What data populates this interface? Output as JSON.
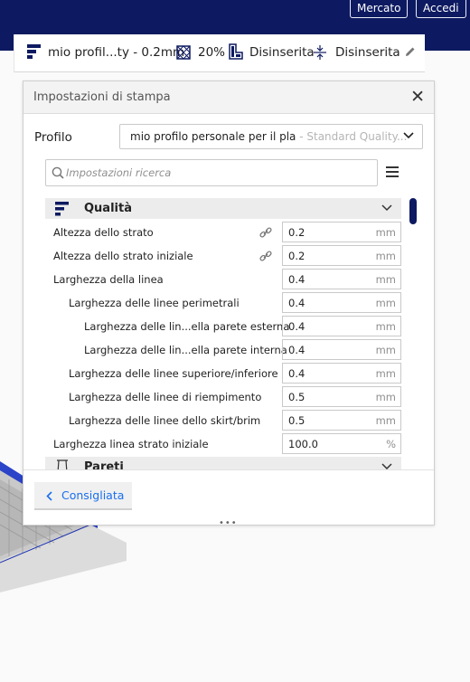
{
  "header": {
    "marketplace_label": "Mercato",
    "signin_label": "Accedi"
  },
  "print_setup": {
    "profile_summary": "mio profil...ty - 0.2mm",
    "infill": "20%",
    "support": "Disinserita",
    "adhesion": "Disinserita"
  },
  "panel": {
    "title": "Impostazioni di stampa",
    "profile_label": "Profilo",
    "profile_value": "mio profilo personale per il pla",
    "profile_quality": " - Standard Quality...",
    "search_placeholder": "Impostazioni ricerca",
    "categories": {
      "quality": "Qualità",
      "walls": "Pareti"
    },
    "rows": [
      {
        "label": "Altezza dello strato",
        "value": "0.2",
        "unit": "mm"
      },
      {
        "label": "Altezza dello strato iniziale",
        "value": "0.2",
        "unit": "mm"
      },
      {
        "label": "Larghezza della linea",
        "value": "0.4",
        "unit": "mm"
      },
      {
        "label": "Larghezza delle linee perimetrali",
        "value": "0.4",
        "unit": "mm"
      },
      {
        "label": "Larghezza delle lin...ella parete esterna",
        "value": "0.4",
        "unit": "mm"
      },
      {
        "label": "Larghezza delle lin...ella parete interna",
        "value": "0.4",
        "unit": "mm"
      },
      {
        "label": "Larghezza delle linee superiore/inferiore",
        "value": "0.4",
        "unit": "mm"
      },
      {
        "label": "Larghezza delle linee di riempimento",
        "value": "0.5",
        "unit": "mm"
      },
      {
        "label": "Larghezza delle linee dello skirt/brim",
        "value": "0.5",
        "unit": "mm"
      },
      {
        "label": "Larghezza linea strato iniziale",
        "value": "100.0",
        "unit": "%"
      }
    ],
    "recommended_label": "Consigliata",
    "drag_handle": "•••"
  },
  "colors": {
    "accent": "#196ef0",
    "navy": "#0d1a61"
  }
}
